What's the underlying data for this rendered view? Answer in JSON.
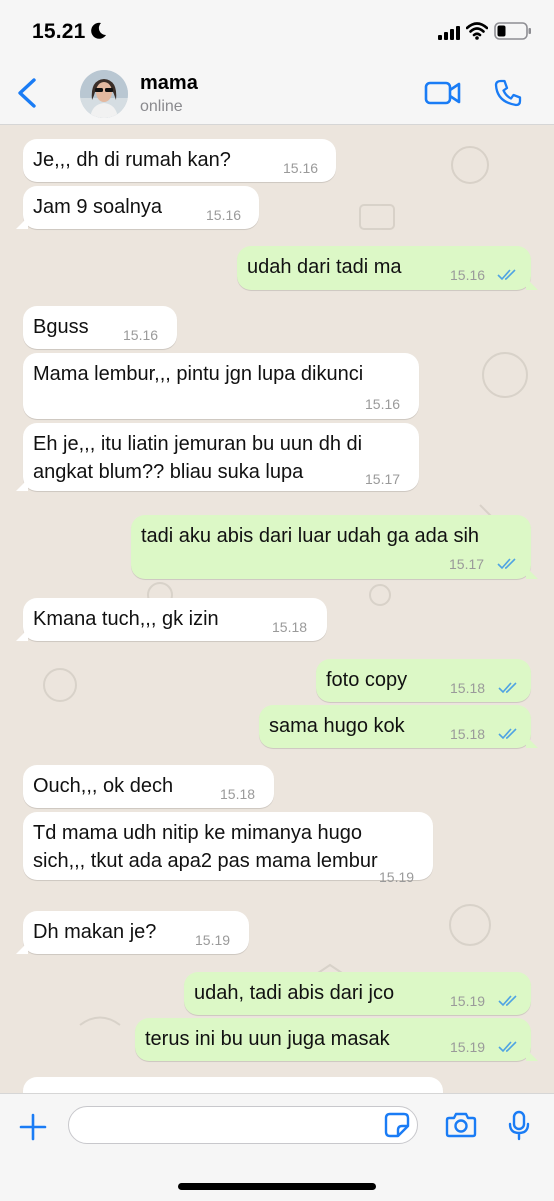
{
  "status_bar": {
    "time": "15.21"
  },
  "header": {
    "contact_name": "mama",
    "contact_status": "online"
  },
  "messages": [
    {
      "dir": "in",
      "text": "Je,,, dh di rumah kan?",
      "time": "15.16"
    },
    {
      "dir": "in",
      "text": "Jam 9 soalnya",
      "time": "15.16"
    },
    {
      "dir": "out",
      "text": "udah dari tadi ma",
      "time": "15.16",
      "read": true
    },
    {
      "dir": "in",
      "text": "Bguss",
      "time": "15.16"
    },
    {
      "dir": "in",
      "text": "Mama lembur,,, pintu jgn lupa dikunci",
      "time": "15.16"
    },
    {
      "dir": "in",
      "text": "Eh je,,, itu liatin jemuran bu uun dh di",
      "text2": "angkat blum?? bliau suka lupa",
      "time": "15.17"
    },
    {
      "dir": "out",
      "text": "tadi aku abis dari luar udah ga ada sih",
      "time": "15.17",
      "read": true
    },
    {
      "dir": "in",
      "text": "Kmana tuch,,, gk izin",
      "time": "15.18"
    },
    {
      "dir": "out",
      "text": "foto copy",
      "time": "15.18",
      "read": true
    },
    {
      "dir": "out",
      "text": "sama hugo kok",
      "time": "15.18",
      "read": true
    },
    {
      "dir": "in",
      "text": "Ouch,,, ok dech",
      "time": "15.18"
    },
    {
      "dir": "in",
      "text": "Td mama udh nitip ke mimanya hugo",
      "text2": "sich,,, tkut ada apa2 pas mama lembur",
      "time": "15.19"
    },
    {
      "dir": "in",
      "text": "Dh makan je?",
      "time": "15.19"
    },
    {
      "dir": "out",
      "text": "udah, tadi abis dari jco",
      "time": "15.19",
      "read": true
    },
    {
      "dir": "out",
      "text": "terus ini bu uun juga masak",
      "time": "15.19",
      "read": true
    }
  ],
  "input": {
    "value": "",
    "placeholder": ""
  },
  "icons": {
    "back": "chevron-left-icon",
    "video": "video-camera-icon",
    "call": "phone-icon",
    "plus": "plus-icon",
    "sticker": "sticker-icon",
    "camera": "camera-icon",
    "mic": "microphone-icon"
  },
  "colors": {
    "accent": "#1a7cf5",
    "incoming": "#ffffff",
    "outgoing": "#dcf8c6",
    "read_ticks": "#4fa3e3",
    "wallpaper": "#ece5dd"
  }
}
